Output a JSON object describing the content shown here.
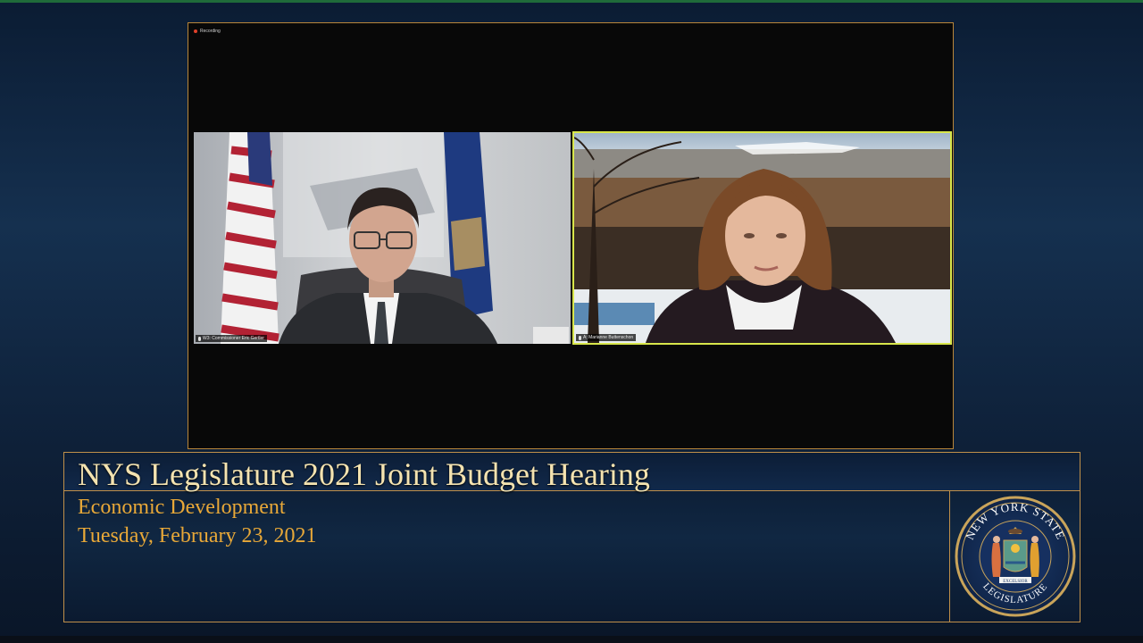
{
  "meeting": {
    "recording_label": "Recording",
    "participants": [
      {
        "name": "W3: Commissioner Eric Gertler"
      },
      {
        "name": "A: Marianne Buttenschon"
      }
    ]
  },
  "caption": {
    "title": "NYS Legislature 2021 Joint Budget Hearing",
    "subtitle": "Economic Development",
    "date": "Tuesday, February 23, 2021"
  },
  "seal": {
    "text_top": "NEW YORK STATE",
    "text_bottom": "LEGISLATURE",
    "motto": "EXCELSIOR"
  },
  "colors": {
    "frame_gold": "#c0904a",
    "title_cream": "#f4e3b0",
    "subtitle_orange": "#e8a838",
    "active_speaker": "#d8e64a"
  }
}
